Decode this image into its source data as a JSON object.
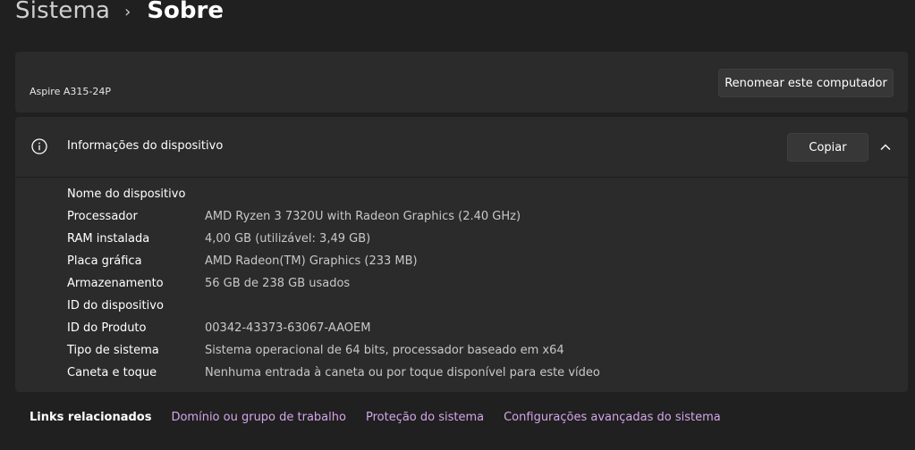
{
  "breadcrumb": {
    "parent": "Sistema",
    "separator": "›",
    "current": "Sobre"
  },
  "device": {
    "name": "Aspire A315-24P",
    "rename_button": "Renomear este computador"
  },
  "info": {
    "icon": "info-icon",
    "title": "Informações do dispositivo",
    "copy_button": "Copiar",
    "collapse_icon": "chevron-up-icon",
    "specs": [
      {
        "label": "Nome do dispositivo",
        "value": ""
      },
      {
        "label": "Processador",
        "value": "AMD Ryzen 3 7320U with Radeon Graphics (2.40 GHz)"
      },
      {
        "label": "RAM instalada",
        "value": "4,00 GB (utilizável: 3,49 GB)"
      },
      {
        "label": "Placa gráfica",
        "value": "AMD Radeon(TM) Graphics (233 MB)"
      },
      {
        "label": "Armazenamento",
        "value": "56 GB de 238 GB usados"
      },
      {
        "label": "ID do dispositivo",
        "value": ""
      },
      {
        "label": "ID do Produto",
        "value": "00342-43373-63067-AAOEM"
      },
      {
        "label": "Tipo de sistema",
        "value": "Sistema operacional de 64 bits, processador baseado em x64"
      },
      {
        "label": "Caneta e toque",
        "value": "Nenhuma entrada à caneta ou por toque disponível para este vídeo"
      }
    ]
  },
  "related": {
    "title": "Links relacionados",
    "links": [
      "Domínio ou grupo de trabalho",
      "Proteção do sistema",
      "Configurações avançadas do sistema"
    ]
  },
  "colors": {
    "background": "#202020",
    "card": "#2b2b2b",
    "button": "#373737",
    "link": "#d4a6e8",
    "secondary_text": "#c8c8c8"
  }
}
